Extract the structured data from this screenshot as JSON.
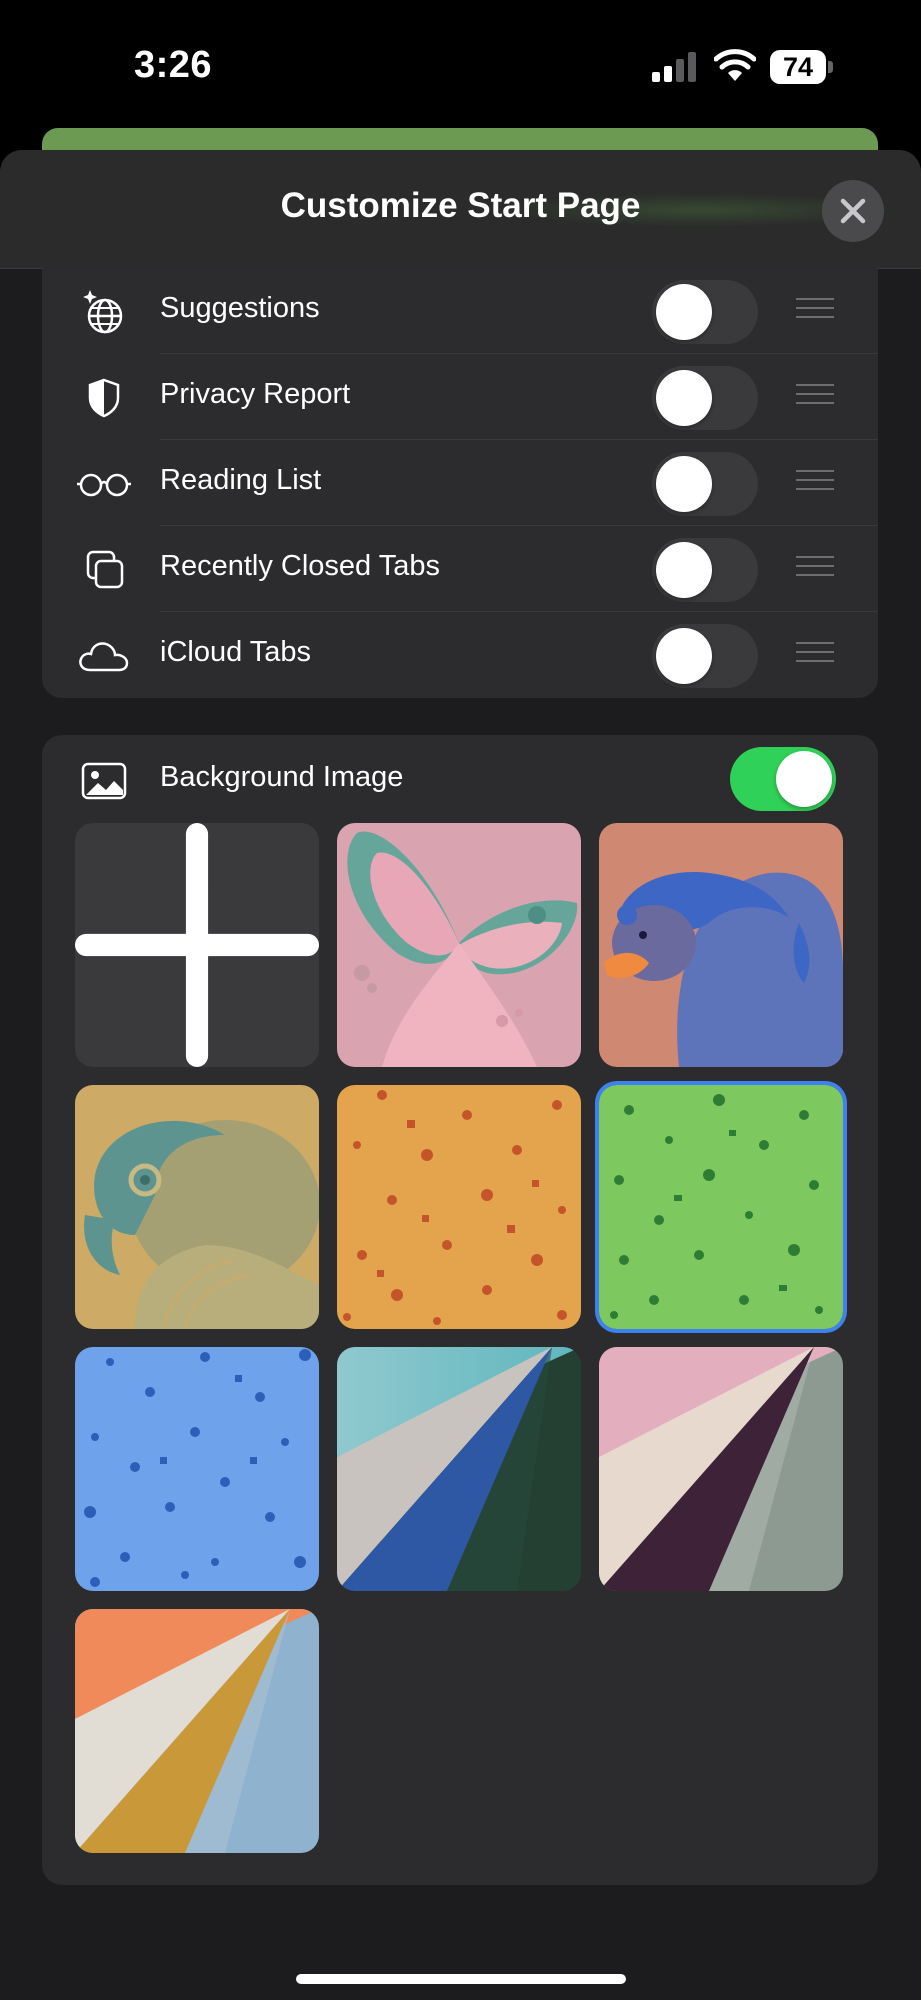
{
  "status_bar": {
    "time": "3:26",
    "battery_level": "74"
  },
  "sheet": {
    "title": "Customize Start Page"
  },
  "sections": [
    {
      "label": "Suggestions",
      "icon": "sparkle-globe-icon",
      "enabled": false
    },
    {
      "label": "Privacy Report",
      "icon": "shield-icon",
      "enabled": false
    },
    {
      "label": "Reading List",
      "icon": "glasses-icon",
      "enabled": false
    },
    {
      "label": "Recently Closed Tabs",
      "icon": "stacked-squares-icon",
      "enabled": false
    },
    {
      "label": "iCloud Tabs",
      "icon": "cloud-icon",
      "enabled": false
    }
  ],
  "background": {
    "label": "Background Image",
    "enabled": true,
    "tiles": [
      "add",
      "butterfly",
      "bear",
      "parrot",
      "orange-pattern",
      "green-pattern",
      "blue-pattern",
      "teal-fold",
      "pink-fold",
      "orange-fold"
    ],
    "selected_index": 5
  },
  "colors": {
    "toggle_on": "#30d158",
    "selection": "#3d82f0",
    "card": "#2c2c2e"
  }
}
